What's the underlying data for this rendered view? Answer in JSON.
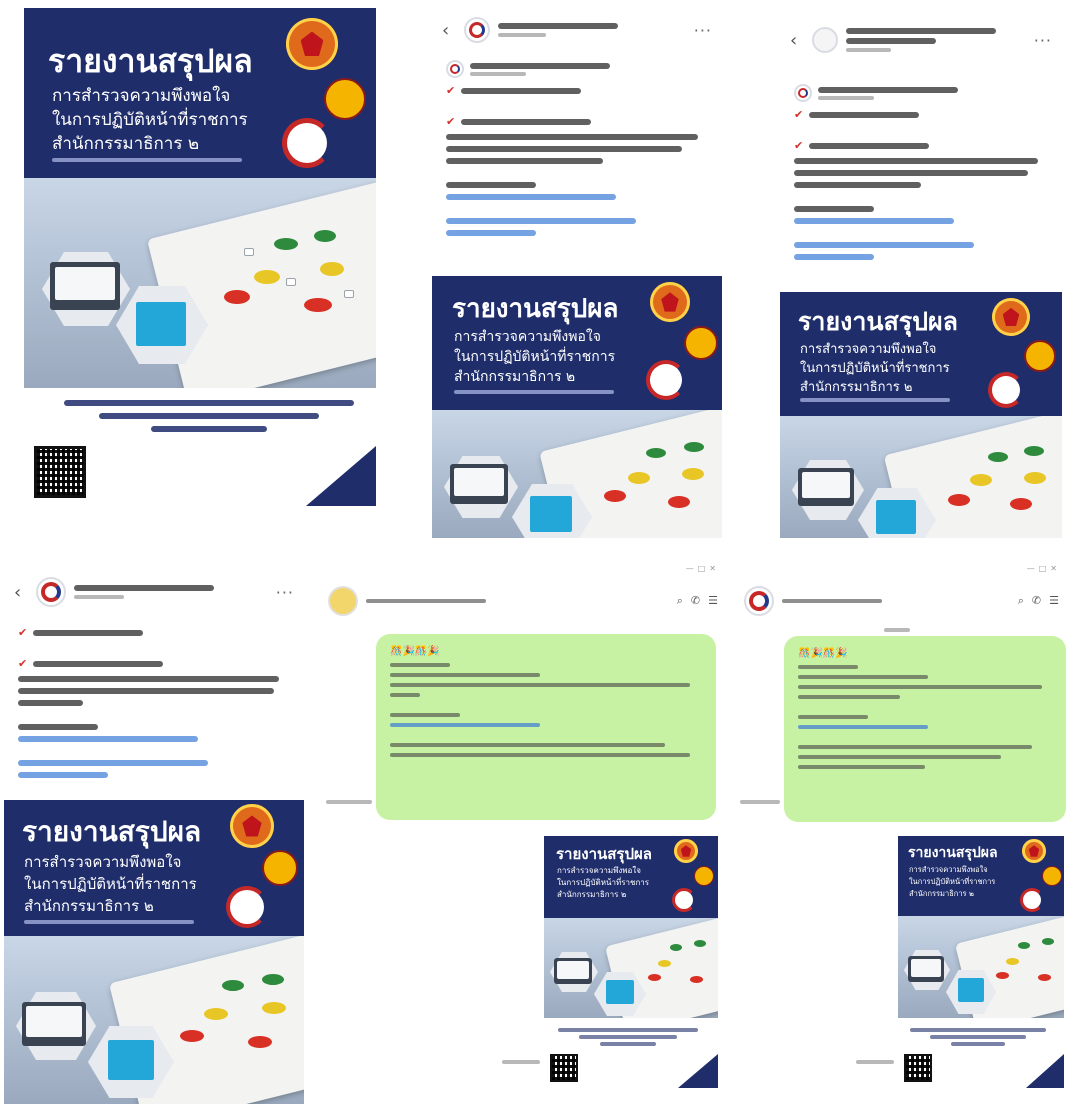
{
  "poster": {
    "title": "รายงานสรุปผล",
    "subtitle_lines": [
      "การสำรวจความพึงพอใจ",
      "ในการปฏิบัติหน้าที่ราชการ",
      "สำนักกรรมาธิการ ๒"
    ]
  },
  "fb_post": {
    "back_icon": "‹",
    "more_icon": "···"
  },
  "chat": {
    "emoji_header": "🎊🎉🎊🎉"
  },
  "colors": {
    "navy": "#1f2d6b",
    "line_green": "#c7f2a4",
    "red": "#c62828",
    "link": "#3b7bd6"
  }
}
